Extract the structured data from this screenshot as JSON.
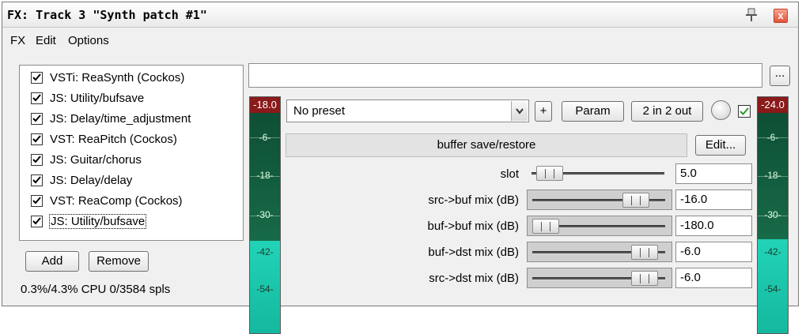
{
  "window": {
    "title": "FX: Track 3 \"Synth patch #1\"",
    "close_glyph": "x"
  },
  "menubar": {
    "items": [
      "FX",
      "Edit",
      "Options"
    ]
  },
  "fx_list": {
    "items": [
      {
        "label": "VSTi: ReaSynth (Cockos)",
        "checked": true
      },
      {
        "label": "JS: Utility/bufsave",
        "checked": true
      },
      {
        "label": "JS: Delay/time_adjustment",
        "checked": true
      },
      {
        "label": "VST: ReaPitch (Cockos)",
        "checked": true
      },
      {
        "label": "JS: Guitar/chorus",
        "checked": true
      },
      {
        "label": "JS: Delay/delay",
        "checked": true
      },
      {
        "label": "VST: ReaComp (Cockos)",
        "checked": true
      },
      {
        "label": "JS: Utility/bufsave",
        "checked": true,
        "selected": true
      }
    ],
    "add_label": "Add",
    "remove_label": "Remove",
    "cpu_status": "0.3%/4.3% CPU 0/3584 spls"
  },
  "toolbar": {
    "browse_label": "...",
    "preset_value": "No preset",
    "add_preset_label": "+",
    "param_label": "Param",
    "io_label": "2 in 2 out",
    "wet_enabled": true
  },
  "input_meter": {
    "peak": "-18.0",
    "ticks": [
      "-6-",
      "-18-",
      "-30-",
      "-42-",
      "-54-"
    ]
  },
  "output_meter": {
    "peak": "-24.0",
    "ticks": [
      "-6-",
      "-18-",
      "-30-",
      "-42-",
      "-54-"
    ]
  },
  "plugin": {
    "name": "buffer save/restore",
    "edit_label": "Edit...",
    "params": [
      {
        "label": "slot",
        "value": "5.0",
        "fraction": 0.04
      },
      {
        "label": "src->buf mix (dB)",
        "value": "-16.0",
        "fraction": 0.84
      },
      {
        "label": "buf->buf mix (dB)",
        "value": "-180.0",
        "fraction": 0.0
      },
      {
        "label": "buf->dst mix (dB)",
        "value": "-6.0",
        "fraction": 0.92
      },
      {
        "label": "src->dst mix (dB)",
        "value": "-6.0",
        "fraction": 0.92
      }
    ]
  },
  "colors": {
    "meter_top": "#0f5a3c",
    "meter_bottom": "#1fc9b0",
    "meter_peak": "#8b1a1a",
    "wet_checkbox": "#2a9a2a"
  }
}
